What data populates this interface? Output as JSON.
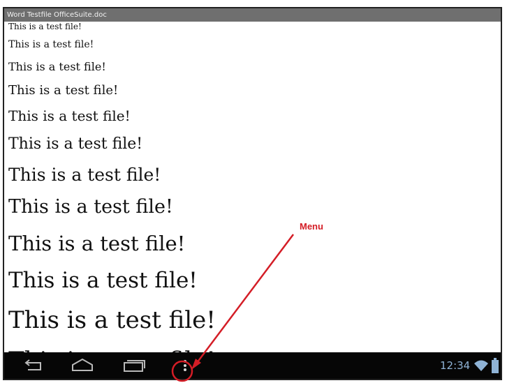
{
  "window": {
    "title": "Word Testfile OfficeSuite.doc"
  },
  "document": {
    "lines": [
      {
        "text": "This is a test file!"
      },
      {
        "text": "This is a test file!"
      },
      {
        "text": "This is a test file!"
      },
      {
        "text": "This is a test file!"
      },
      {
        "text": "This is a test file!"
      },
      {
        "text": "This is a test file!"
      },
      {
        "text": "This is a test file!"
      },
      {
        "text": "This is a test file!"
      },
      {
        "text": "This is a test file!"
      },
      {
        "text": "This is a test file!"
      },
      {
        "text": "This is a test file!"
      },
      {
        "text": "This is a test file!"
      }
    ]
  },
  "navbar": {
    "buttons": [
      {
        "name": "back",
        "icon": "back-arrow-icon"
      },
      {
        "name": "home",
        "icon": "home-icon"
      },
      {
        "name": "recent-apps",
        "icon": "recent-apps-icon"
      },
      {
        "name": "menu",
        "icon": "overflow-menu-icon"
      }
    ],
    "status": {
      "time": "12:34",
      "wifi_icon": "wifi-icon",
      "battery_icon": "battery-icon"
    }
  },
  "annotation": {
    "label": "Menu",
    "color": "#d41d26"
  }
}
